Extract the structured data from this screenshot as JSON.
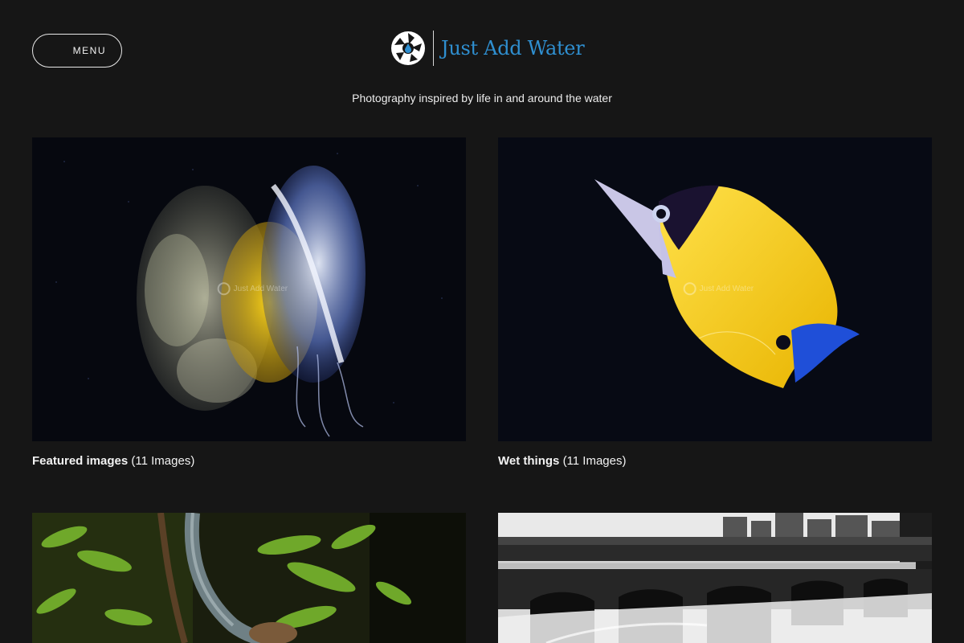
{
  "header": {
    "menu_label": "MENU",
    "logo_text": "Just Add Water",
    "tagline": "Photography inspired by life in and around the water"
  },
  "colors": {
    "background": "#161616",
    "logo_text": "#2f8fd0",
    "text": "#f2f2f2"
  },
  "galleries": [
    {
      "title": "Featured images",
      "count": "(11 Images)",
      "image": "jellyfish-photo"
    },
    {
      "title": "Wet things",
      "count": "(11 Images)",
      "image": "yellow-longnose-butterflyfish-photo"
    },
    {
      "title": "",
      "count": "",
      "image": "green-fern-branch-photo"
    },
    {
      "title": "",
      "count": "",
      "image": "black-white-dam-bridge-photo"
    }
  ],
  "watermark_text": "Just Add Water"
}
